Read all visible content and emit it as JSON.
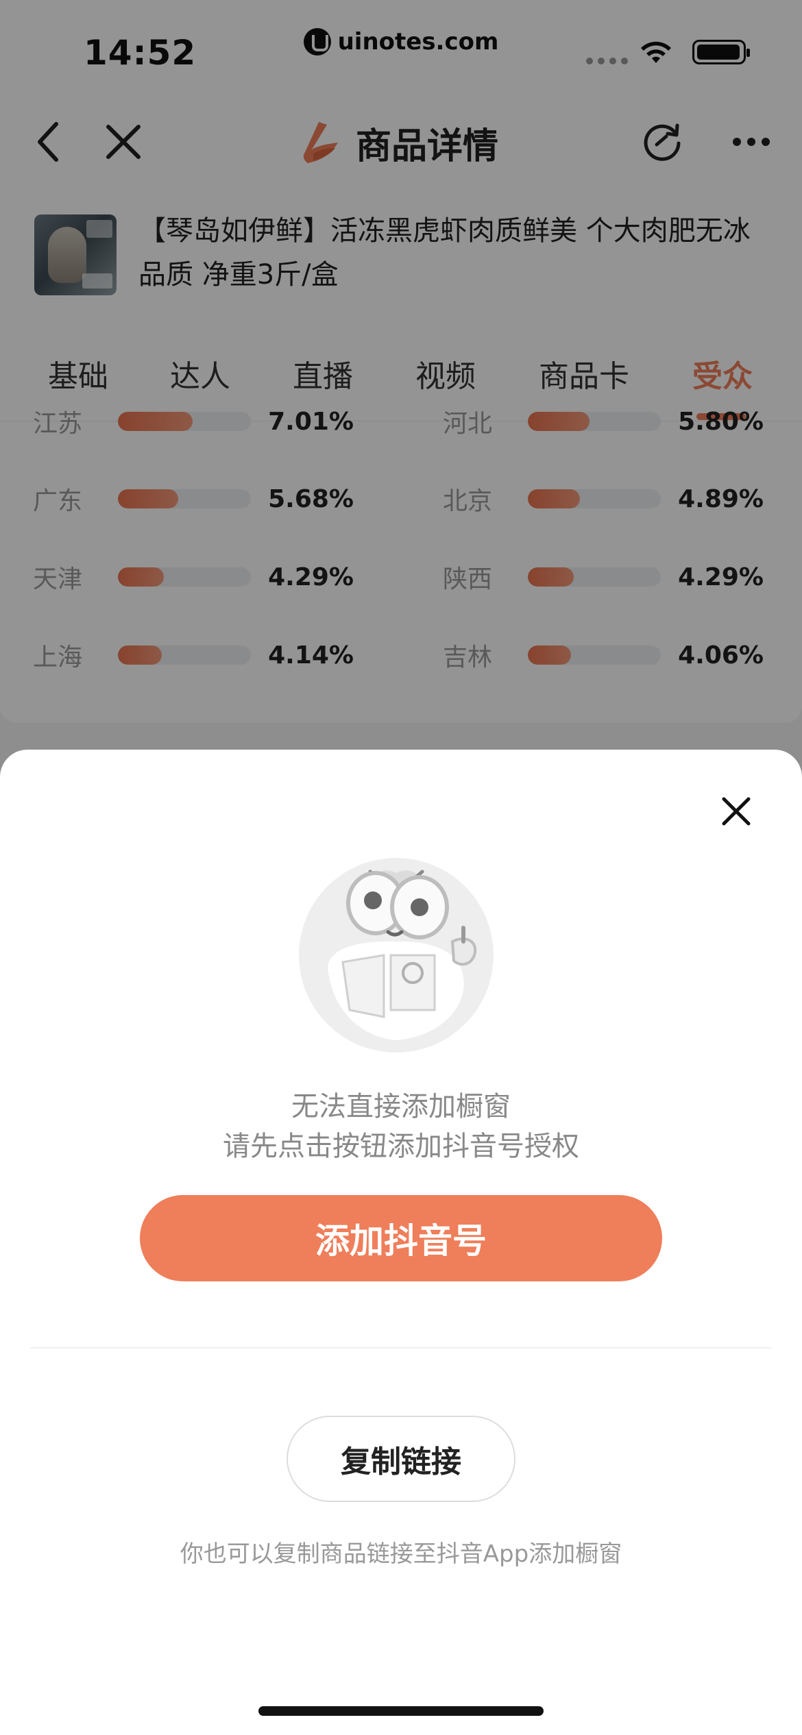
{
  "status_bar": {
    "time": "14:52",
    "watermark": "uinotes.com"
  },
  "nav": {
    "title": "商品详情",
    "back_icon": "chevron-left-icon",
    "close_icon": "close-icon",
    "refresh_icon": "refresh-icon",
    "more_icon": "more-dots-icon",
    "brand_color": "#ef7e5a"
  },
  "product": {
    "title": "【琴岛如伊鲜】活冻黑虎虾肉质鲜美 个大肉肥无冰品质 净重3斤/盒"
  },
  "tabs": [
    {
      "label": "基础",
      "active": false
    },
    {
      "label": "达人",
      "active": false
    },
    {
      "label": "直播",
      "active": false
    },
    {
      "label": "视频",
      "active": false
    },
    {
      "label": "商品卡",
      "active": false
    },
    {
      "label": "受众",
      "active": true
    }
  ],
  "region_distribution": [
    {
      "left": {
        "name": "江苏",
        "percent": "7.01%",
        "value": 7.01
      },
      "right": {
        "name": "河北",
        "percent": "5.80%",
        "value": 5.8
      }
    },
    {
      "left": {
        "name": "广东",
        "percent": "5.68%",
        "value": 5.68
      },
      "right": {
        "name": "北京",
        "percent": "4.89%",
        "value": 4.89
      }
    },
    {
      "left": {
        "name": "天津",
        "percent": "4.29%",
        "value": 4.29
      },
      "right": {
        "name": "陕西",
        "percent": "4.29%",
        "value": 4.29
      }
    },
    {
      "left": {
        "name": "上海",
        "percent": "4.14%",
        "value": 4.14
      },
      "right": {
        "name": "吉林",
        "percent": "4.06%",
        "value": 4.06
      }
    }
  ],
  "sheet": {
    "close_icon": "close-icon",
    "mascot": "mascot-illustration",
    "message_line1": "无法直接添加橱窗",
    "message_line2": "请先点击按钮添加抖音号授权",
    "primary_button": "添加抖音号",
    "secondary_button": "复制链接",
    "hint": "你也可以复制商品链接至抖音App添加橱窗",
    "accent_color": "#ef7e5a"
  }
}
